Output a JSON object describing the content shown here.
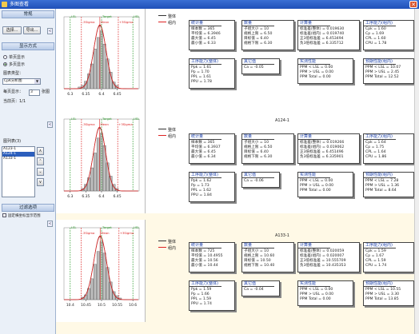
{
  "window": {
    "title": "多图查看",
    "close_glyph": "✕"
  },
  "sidebar": {
    "sections": {
      "general": "常规",
      "display_mode": "显示方式",
      "filter": "过滤选项"
    },
    "buttons": {
      "select": "选择...",
      "export": "导出..."
    },
    "display_modes": [
      "单页显示",
      "多页显示"
    ],
    "selected_mode": 1,
    "chart_type_label": "图表类型：",
    "chart_type_value": "CpK分析图",
    "per_page_label": "每页显示：",
    "per_page_value": "3",
    "per_page_unit": "张图",
    "current_page_label": "当前页：1/1",
    "charts_label": "图列表(3)",
    "chart_list": [
      "A123-1",
      "A124-1",
      "A133-1"
    ],
    "selected_chart": 1,
    "arrows": [
      "∧",
      "∨",
      "⌃",
      "⌄"
    ],
    "filter_checkbox_label": "固定横坐标显示范围",
    "collapse_glyph": "<"
  },
  "legend": {
    "overall": "整体",
    "within": "组内"
  },
  "box_titles": {
    "stats": "统计量",
    "sample": "数量",
    "calc": "计算量",
    "capability": "工序能力(组内)",
    "capability_overall": "工序能力(整体)",
    "other": "其它值",
    "perf_actual": "实测性能",
    "perf_expected": "预期性能(组内)"
  },
  "panels": [
    {
      "title": "",
      "hist_labels": {
        "lsl": "LSL",
        "target": "Target",
        "usl": "USL",
        "m3": "-3Sigma",
        "mean": "Mean",
        "p3": "+3Sigma"
      },
      "stats": [
        "样本数 = 365",
        "平均值 = 6.3946",
        "最大值 = 6.45",
        "最小值 = 6.33"
      ],
      "sample": [
        "子组大小 = 10",
        "规格上限 = 6.50",
        "目标值 = 6.40",
        "规格下限 = 6.30"
      ],
      "calc": [
        "标准差(整体) = 0.019630",
        "标准差(组内) = 0.019740",
        "正3倍标准差 = 6.453494",
        "负3倍标准差 = 6.335712"
      ],
      "capability": [
        "Cpk = 1.60",
        "Cp = 1.69",
        "CPL = 1.60",
        "CPU = 1.78"
      ],
      "capability_overall": [
        "Ppk = 1.61",
        "Pp = 1.70",
        "PPL = 1.61",
        "PPU = 1.78"
      ],
      "other": [
        "Ca = -0.05"
      ],
      "perf_actual": [
        "PPM < LSL = 0.00",
        "PPM > USL = 0.00",
        "PPM Total = 0.00"
      ],
      "perf_expected": [
        "PPM < LSL = 10.07",
        "PPM > USL = 2.45",
        "PPM Total = 12.52"
      ]
    },
    {
      "title": "A124-1",
      "hist_labels": {
        "lsl": "LSL",
        "target": "Target",
        "usl": "USL",
        "m3": "-3Sigma",
        "mean": "Mean",
        "p3": "+3Sigma"
      },
      "stats": [
        "样本数 = 365",
        "平均值 = 6.3937",
        "最大值 = 6.45",
        "最小值 = 6.34"
      ],
      "sample": [
        "子组大小 = 10",
        "规格上限 = 6.50",
        "目标值 = 6.40",
        "规格下限 = 6.30"
      ],
      "calc": [
        "标准差(整体) = 0.019266",
        "标准差(组内) = 0.019062",
        "正3倍标准差 = 6.451496",
        "负3倍标准差 = 6.335901"
      ],
      "capability": [
        "Cpk = 1.64",
        "Cp = 1.75",
        "CPL = 1.64",
        "CPU = 1.86"
      ],
      "capability_overall": [
        "Ppk = 1.62",
        "Pp = 1.73",
        "PPL = 1.62",
        "PPU = 1.84"
      ],
      "other": [
        "Ca = -0.06"
      ],
      "perf_actual": [
        "PPM < LSL = 0.00",
        "PPM > USL = 0.00",
        "PPM Total = 0.00"
      ],
      "perf_expected": [
        "PPM < LSL = 7.28",
        "PPM > USL = 1.36",
        "PPM Total = 8.64"
      ]
    },
    {
      "title": "A133-1",
      "hist_labels": {
        "lsl": "LSL",
        "target": "Target",
        "usl": "USL",
        "m3": "-3Sigma",
        "mean": "Mean",
        "p3": "+3Sigma"
      },
      "stats": [
        "样本数 = 725",
        "平均值 = 10.4955",
        "最大值 = 10.56",
        "最小值 = 10.44"
      ],
      "sample": [
        "子组大小 = 10",
        "规格上限 = 10.60",
        "目标值 = 10.50",
        "规格下限 = 10.40"
      ],
      "calc": [
        "标准差(整体) = 0.020059",
        "标准差(组内) = 0.020007",
        "正3倍标准差 = 10.555709",
        "负3倍标准差 = 10.435353"
      ],
      "capability": [
        "Cpk = 1.59",
        "Cp = 1.67",
        "CPL = 1.59",
        "CPU = 1.74"
      ],
      "capability_overall": [
        "Ppk = 1.59",
        "Pp = 1.66",
        "PPL = 1.59",
        "PPU = 1.74"
      ],
      "other": [
        "Ca = -0.04"
      ],
      "perf_actual": [
        "PPM < LSL = 0.00",
        "PPM > USL = 0.00",
        "PPM Total = 0.00"
      ],
      "perf_expected": [
        "PPM < LSL = 10.55",
        "PPM > USL = 3.30",
        "PPM Total = 13.85"
      ]
    }
  ],
  "chart_data": [
    {
      "type": "bar",
      "categories": [
        "6.33",
        "6.34",
        "6.35",
        "6.36",
        "6.37",
        "6.38",
        "6.39",
        "6.40",
        "6.41",
        "6.42",
        "6.43",
        "6.44",
        "6.45"
      ],
      "values": [
        2,
        4,
        9,
        18,
        30,
        48,
        62,
        70,
        54,
        36,
        20,
        8,
        4
      ],
      "xticks": [
        "6.3",
        "6.35",
        "6.4",
        "6.45"
      ],
      "xlim": [
        6.28,
        6.52
      ],
      "lsl": 6.3,
      "target": 6.4,
      "usl": 6.5,
      "mean": 6.3946,
      "minus3": 6.3357,
      "plus3": 6.4535
    },
    {
      "type": "bar",
      "categories": [
        "6.34",
        "6.35",
        "6.36",
        "6.37",
        "6.38",
        "6.39",
        "6.40",
        "6.41",
        "6.42",
        "6.43",
        "6.44",
        "6.45"
      ],
      "values": [
        3,
        8,
        16,
        28,
        46,
        64,
        70,
        55,
        34,
        18,
        8,
        3
      ],
      "xticks": [
        "6.3",
        "6.35",
        "6.4",
        "6.45"
      ],
      "xlim": [
        6.28,
        6.52
      ],
      "lsl": 6.3,
      "target": 6.4,
      "usl": 6.5,
      "mean": 6.3937,
      "minus3": 6.3359,
      "plus3": 6.4515
    },
    {
      "type": "bar",
      "categories": [
        "10.44",
        "10.45",
        "10.46",
        "10.47",
        "10.48",
        "10.49",
        "10.50",
        "10.51",
        "10.52",
        "10.53",
        "10.54",
        "10.55",
        "10.56"
      ],
      "values": [
        3,
        6,
        14,
        26,
        44,
        60,
        72,
        58,
        40,
        22,
        10,
        5,
        2
      ],
      "xticks": [
        "10.4",
        "10.45",
        "10.5",
        "10.55",
        "10.6"
      ],
      "xlim": [
        10.38,
        10.62
      ],
      "lsl": 10.4,
      "target": 10.5,
      "usl": 10.6,
      "mean": 10.4955,
      "minus3": 10.4354,
      "plus3": 10.5557
    }
  ]
}
